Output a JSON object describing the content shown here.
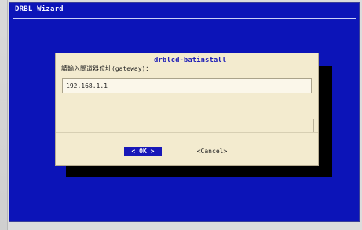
{
  "window": {
    "title": "DRBL Wizard"
  },
  "dialog": {
    "title": "drblcd-batinstall",
    "prompt": "請輸入閘道器位址(gateway)：",
    "input_value": "192.168.1.1",
    "ok_label": "< OK >",
    "cancel_label": "<Cancel>"
  },
  "colors": {
    "screen_background": "#0c14b8",
    "dialog_background": "#f3ebcf",
    "selected_button": "#1818b8"
  }
}
